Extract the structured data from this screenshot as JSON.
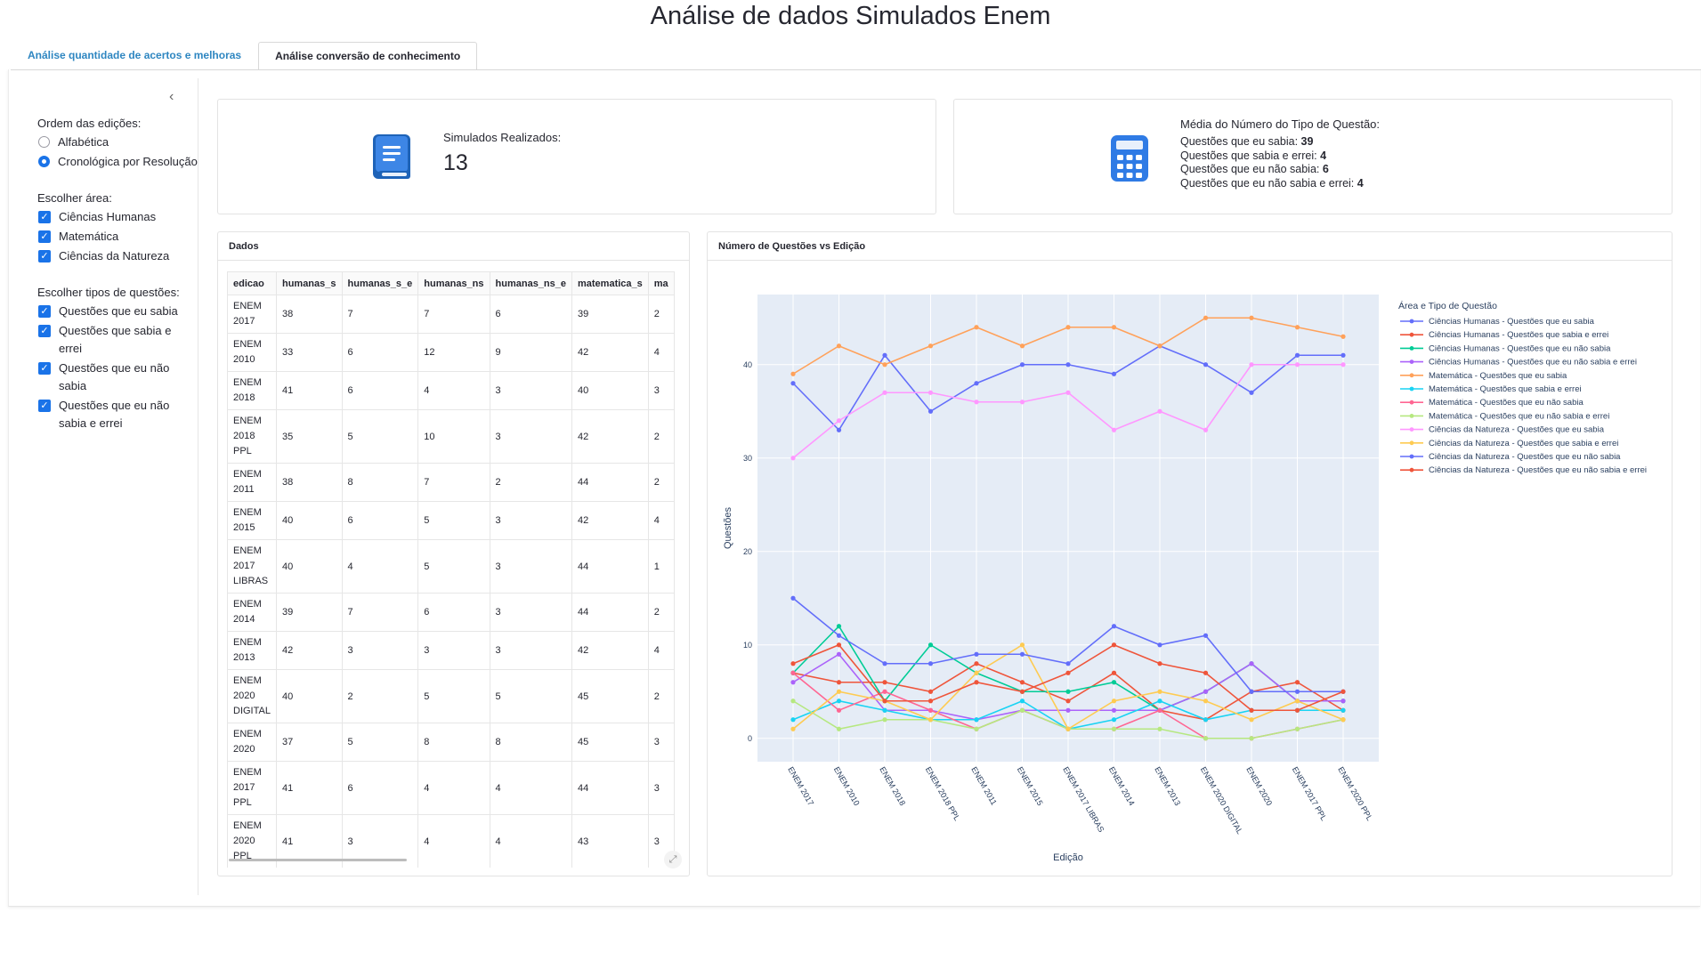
{
  "app": {
    "title": "Análise de dados Simulados Enem",
    "tabs": [
      {
        "label": "Análise quantidade de acertos e melhoras",
        "active": false
      },
      {
        "label": "Análise conversão de conhecimento",
        "active": true
      }
    ]
  },
  "sidebar": {
    "order_label": "Ordem das edições:",
    "order_options": [
      {
        "label": "Alfabética",
        "selected": false
      },
      {
        "label": "Cronológica por Resolução",
        "selected": true
      }
    ],
    "area_label": "Escolher área:",
    "areas": [
      {
        "label": "Ciências Humanas",
        "checked": true
      },
      {
        "label": "Matemática",
        "checked": true
      },
      {
        "label": "Ciências da Natureza",
        "checked": true
      }
    ],
    "types_label": "Escolher tipos de questões:",
    "types": [
      {
        "label": "Questões que eu sabia",
        "checked": true
      },
      {
        "label": "Questões que sabia e errei",
        "checked": true
      },
      {
        "label": "Questões que eu não sabia",
        "checked": true
      },
      {
        "label": "Questões que eu não sabia e errei",
        "checked": true
      }
    ]
  },
  "kpi_simulados": {
    "icon": "book-icon",
    "label": "Simulados Realizados:",
    "value": "13"
  },
  "kpi_media": {
    "icon": "calculator-icon",
    "title": "Média do Número do Tipo de Questão:",
    "items": [
      {
        "label": "Questões que eu sabia:",
        "value": "39"
      },
      {
        "label": "Questões que sabia e errei:",
        "value": "4"
      },
      {
        "label": "Questões que eu não sabia:",
        "value": "6"
      },
      {
        "label": "Questões que eu não sabia e errei:",
        "value": "4"
      }
    ]
  },
  "table": {
    "title": "Dados",
    "columns": [
      "edicao",
      "humanas_s",
      "humanas_s_e",
      "humanas_ns",
      "humanas_ns_e",
      "matematica_s",
      "ma"
    ],
    "rows": [
      [
        "ENEM 2017",
        "38",
        "7",
        "7",
        "6",
        "39",
        "2"
      ],
      [
        "ENEM 2010",
        "33",
        "6",
        "12",
        "9",
        "42",
        "4"
      ],
      [
        "ENEM 2018",
        "41",
        "6",
        "4",
        "3",
        "40",
        "3"
      ],
      [
        "ENEM 2018 PPL",
        "35",
        "5",
        "10",
        "3",
        "42",
        "2"
      ],
      [
        "ENEM 2011",
        "38",
        "8",
        "7",
        "2",
        "44",
        "2"
      ],
      [
        "ENEM 2015",
        "40",
        "6",
        "5",
        "3",
        "42",
        "4"
      ],
      [
        "ENEM 2017 LIBRAS",
        "40",
        "4",
        "5",
        "3",
        "44",
        "1"
      ],
      [
        "ENEM 2014",
        "39",
        "7",
        "6",
        "3",
        "44",
        "2"
      ],
      [
        "ENEM 2013",
        "42",
        "3",
        "3",
        "3",
        "42",
        "4"
      ],
      [
        "ENEM 2020 DIGITAL",
        "40",
        "2",
        "5",
        "5",
        "45",
        "2"
      ],
      [
        "ENEM 2020",
        "37",
        "5",
        "8",
        "8",
        "45",
        "3"
      ],
      [
        "ENEM 2017 PPL",
        "41",
        "6",
        "4",
        "4",
        "44",
        "3"
      ],
      [
        "ENEM 2020 PPL",
        "41",
        "3",
        "4",
        "4",
        "43",
        "3"
      ]
    ]
  },
  "chart_card": {
    "title": "Número de Questões vs Edição"
  },
  "chart_data": {
    "type": "line",
    "xlabel": "Edição",
    "ylabel": "Questões",
    "ylim": [
      -2.5,
      47.5
    ],
    "yticks": [
      0,
      10,
      20,
      30,
      40
    ],
    "grid": true,
    "legend_title": "Área e Tipo de Questão",
    "legend_position": "right",
    "categories": [
      "ENEM 2017",
      "ENEM 2010",
      "ENEM 2018",
      "ENEM 2018 PPL",
      "ENEM 2011",
      "ENEM 2015",
      "ENEM 2017 LIBRAS",
      "ENEM 2014",
      "ENEM 2013",
      "ENEM 2020 DIGITAL",
      "ENEM 2020",
      "ENEM 2017 PPL",
      "ENEM 2020 PPL"
    ],
    "series": [
      {
        "name": "Ciências Humanas - Questões que eu sabia",
        "color": "#636efa",
        "values": [
          38,
          33,
          41,
          35,
          38,
          40,
          40,
          39,
          42,
          40,
          37,
          41,
          41
        ]
      },
      {
        "name": "Ciências Humanas - Questões que sabia e errei",
        "color": "#ef553b",
        "values": [
          7,
          6,
          6,
          5,
          8,
          6,
          4,
          7,
          3,
          2,
          5,
          6,
          3
        ]
      },
      {
        "name": "Ciências Humanas - Questões que eu não sabia",
        "color": "#00cc96",
        "values": [
          7,
          12,
          4,
          10,
          7,
          5,
          5,
          6,
          3,
          5,
          8,
          4,
          4
        ]
      },
      {
        "name": "Ciências Humanas - Questões que eu não sabia e errei",
        "color": "#ab63fa",
        "values": [
          6,
          9,
          3,
          3,
          2,
          3,
          3,
          3,
          3,
          5,
          8,
          4,
          4
        ]
      },
      {
        "name": "Matemática - Questões que eu sabia",
        "color": "#ffa15a",
        "values": [
          39,
          42,
          40,
          42,
          44,
          42,
          44,
          44,
          42,
          45,
          45,
          44,
          43
        ]
      },
      {
        "name": "Matemática - Questões que sabia e errei",
        "color": "#19d3f3",
        "values": [
          2,
          4,
          3,
          2,
          2,
          4,
          1,
          2,
          4,
          2,
          3,
          3,
          3
        ]
      },
      {
        "name": "Matemática - Questões que eu não sabia",
        "color": "#ff6692",
        "values": [
          7,
          3,
          5,
          3,
          1,
          3,
          1,
          1,
          3,
          0,
          0,
          1,
          2
        ]
      },
      {
        "name": "Matemática - Questões que eu não sabia e errei",
        "color": "#b6e880",
        "values": [
          4,
          1,
          2,
          2,
          1,
          3,
          1,
          1,
          1,
          0,
          0,
          1,
          2
        ]
      },
      {
        "name": "Ciências da Natureza - Questões que eu sabia",
        "color": "#ff97ff",
        "values": [
          30,
          34,
          37,
          37,
          36,
          36,
          37,
          33,
          35,
          33,
          40,
          40,
          40
        ]
      },
      {
        "name": "Ciências da Natureza - Questões que sabia e errei",
        "color": "#fecb52",
        "values": [
          1,
          5,
          4,
          2,
          7,
          10,
          1,
          4,
          5,
          4,
          2,
          4,
          2
        ]
      },
      {
        "name": "Ciências da Natureza - Questões que eu não sabia",
        "color": "#636efa",
        "values": [
          15,
          11,
          8,
          8,
          9,
          9,
          8,
          12,
          10,
          11,
          5,
          5,
          5
        ]
      },
      {
        "name": "Ciências da Natureza - Questões que eu não sabia e errei",
        "color": "#ef553b",
        "values": [
          8,
          10,
          4,
          4,
          6,
          5,
          7,
          10,
          8,
          7,
          3,
          3,
          5
        ]
      }
    ]
  }
}
